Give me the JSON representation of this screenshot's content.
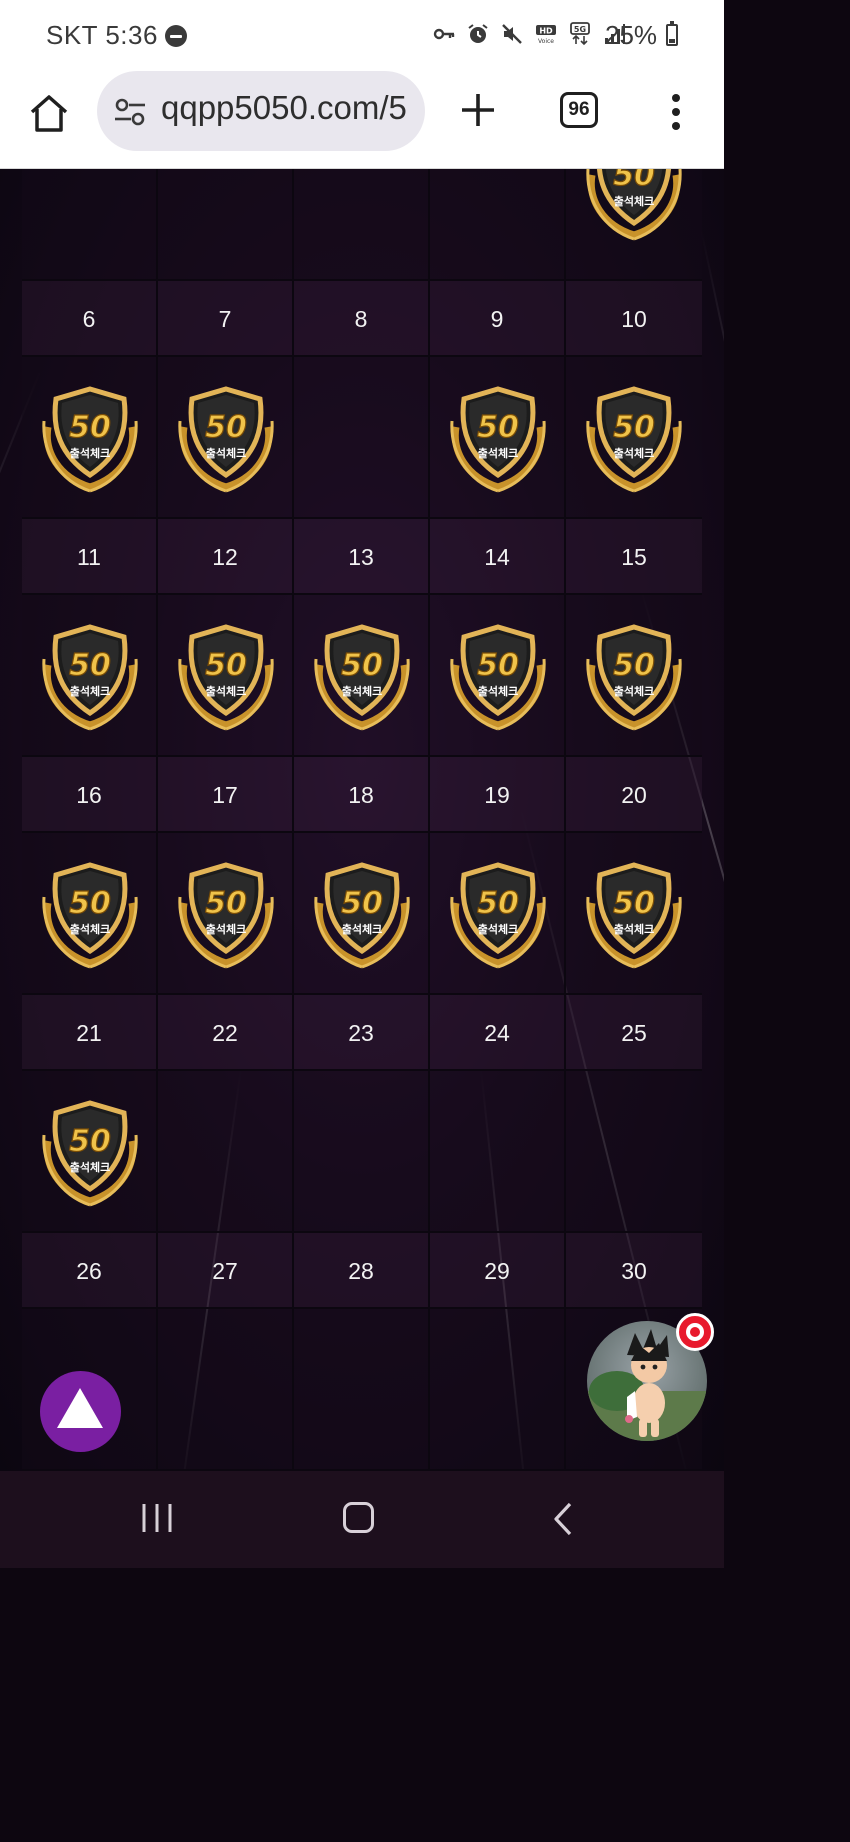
{
  "status_bar": {
    "carrier_time": "SKT 5:36",
    "battery": "25%",
    "icons": [
      "dnd-icon",
      "vpn-key-icon",
      "alarm-icon",
      "mute-icon",
      "hd-voice-icon",
      "5g-icon",
      "signal-icon",
      "battery-icon"
    ]
  },
  "browser": {
    "url": "qqpp5050.com/5",
    "tab_count": "96"
  },
  "calendar": {
    "badge_text_number": "50",
    "badge_text_label": "출석체크",
    "weeks": [
      {
        "days": [
          "",
          "",
          "",
          "",
          ""
        ],
        "checked": [
          false,
          false,
          false,
          false,
          true
        ]
      },
      {
        "days": [
          "6",
          "7",
          "8",
          "9",
          "10"
        ],
        "checked": [
          true,
          true,
          false,
          true,
          true
        ]
      },
      {
        "days": [
          "11",
          "12",
          "13",
          "14",
          "15"
        ],
        "checked": [
          true,
          true,
          true,
          true,
          true
        ]
      },
      {
        "days": [
          "16",
          "17",
          "18",
          "19",
          "20"
        ],
        "checked": [
          true,
          true,
          true,
          true,
          true
        ]
      },
      {
        "days": [
          "21",
          "22",
          "23",
          "24",
          "25"
        ],
        "checked": [
          true,
          false,
          false,
          false,
          false
        ]
      },
      {
        "days": [
          "26",
          "27",
          "28",
          "29",
          "30"
        ],
        "checked": [
          false,
          false,
          false,
          false,
          false
        ]
      }
    ]
  },
  "colors": {
    "scroll_top_button": "#7a1fa2",
    "badge_gold": "#d9a63a",
    "record_dot": "#e8192c"
  }
}
